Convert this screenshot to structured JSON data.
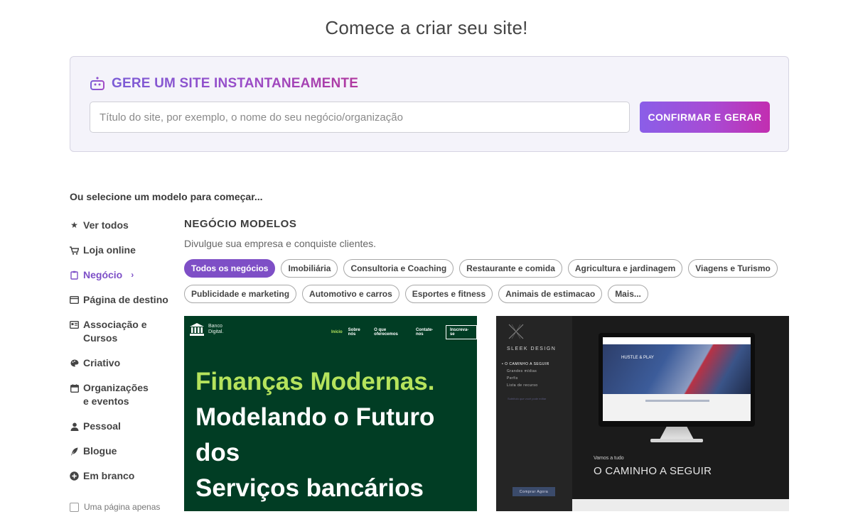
{
  "page": {
    "title": "Comece a criar seu site!"
  },
  "generator": {
    "heading": "GERE UM SITE INSTANTANEAMENTE",
    "input_placeholder": "Título do site, por exemplo, o nome do seu negócio/organização",
    "input_value": "",
    "button_label": "CONFIRMAR E GERAR",
    "colors": {
      "gradient_start": "#8a5ee8",
      "gradient_end": "#c22eb0"
    }
  },
  "select_prompt": "Ou selecione um modelo para começar...",
  "sidebar": {
    "items": [
      {
        "icon": "star-icon",
        "label": "Ver todos",
        "active": false
      },
      {
        "icon": "cart-icon",
        "label": "Loja online",
        "active": false
      },
      {
        "icon": "clipboard-icon",
        "label": "Negócio",
        "active": true,
        "chevron": "›"
      },
      {
        "icon": "window-icon",
        "label": "Página de destino",
        "active": false
      },
      {
        "icon": "id-card-icon",
        "label": "Associação e Cursos",
        "active": false
      },
      {
        "icon": "palette-icon",
        "label": "Criativo",
        "active": false
      },
      {
        "icon": "calendar-icon",
        "label": "Organizações e eventos",
        "active": false
      },
      {
        "icon": "person-icon",
        "label": "Pessoal",
        "active": false
      },
      {
        "icon": "feather-icon",
        "label": "Blogue",
        "active": false
      },
      {
        "icon": "plus-circle-icon",
        "label": "Em branco",
        "active": false
      }
    ],
    "one_page_label": "Uma página apenas",
    "one_page_checked": false
  },
  "category": {
    "title": "NEGÓCIO MODELOS",
    "description": "Divulgue sua empresa e conquiste clientes.",
    "chips": [
      {
        "label": "Todos os negócios",
        "active": true
      },
      {
        "label": "Imobiliária",
        "active": false
      },
      {
        "label": "Consultoria e Coaching",
        "active": false
      },
      {
        "label": "Restaurante e comida",
        "active": false
      },
      {
        "label": "Agricultura e jardinagem",
        "active": false
      },
      {
        "label": "Viagens e Turismo",
        "active": false
      },
      {
        "label": "Publicidade e marketing",
        "active": false
      },
      {
        "label": "Automotivo e carros",
        "active": false
      },
      {
        "label": "Esportes e fitness",
        "active": false
      },
      {
        "label": "Animais de estimacao",
        "active": false
      },
      {
        "label": "Mais...",
        "active": false
      }
    ]
  },
  "templates": [
    {
      "logo_text_1": "Banco",
      "logo_text_2": "Digital.",
      "nav": [
        "Início",
        "Sobre nós",
        "O que oferecemos",
        "Contate-nos"
      ],
      "nav_cta": "Inscreva-se",
      "hero_lines": [
        "Finanças Modernas.",
        "Modelando o Futuro",
        "dos",
        "Serviços bancários"
      ],
      "colors": {
        "bg": "#013d24",
        "accent": "#b5e35c"
      }
    },
    {
      "brand": "SLEEK DESIGN",
      "menu": [
        "O CAMINHO A SEGUIR",
        "Grandes mídias",
        "Perfis",
        "Lista de recurso"
      ],
      "tagline": "Subtítulo que você pode editar",
      "buy_label": "Comprar Agora",
      "screen_text": "HUSTLE & PLAY",
      "small_text": "Vamos a tudo",
      "big_text": "O CAMINHO A SEGUIR"
    }
  ]
}
